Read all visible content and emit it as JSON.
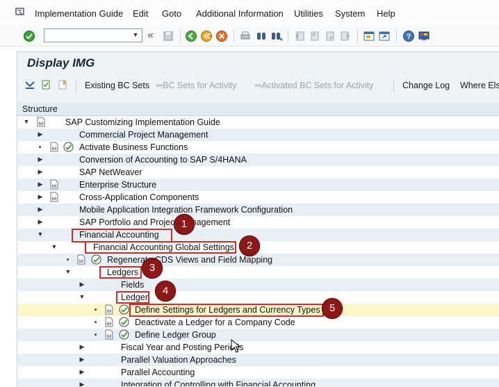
{
  "menubar": {
    "items": [
      "Implementation Guide",
      "Edit",
      "Goto",
      "Additional Information",
      "Utilities",
      "System",
      "Help"
    ]
  },
  "toolbar": {
    "command_value": "",
    "icons": [
      "enter-check-icon",
      "command-field",
      "collapse-arrows-icon",
      "save-icon",
      "back-icon",
      "exit-icon",
      "cancel-icon",
      "print-icon",
      "find-icon",
      "find-next-icon",
      "first-page-icon",
      "previous-page-icon",
      "next-page-icon",
      "last-page-icon",
      "new-session-icon",
      "shortcut-icon",
      "help-icon",
      "layout-icon"
    ]
  },
  "title": "Display IMG",
  "appbar": {
    "existing_bc_sets": "Existing BC Sets",
    "bc_sets_for_activity": "BC Sets for Activity",
    "activated_bc_sets": "Activated BC Sets for Activity",
    "change_log": "Change Log",
    "where_else": "Where Els"
  },
  "tree": {
    "header": "Structure",
    "rows": [
      {
        "label": "SAP Customizing Implementation Guide"
      },
      {
        "label": "Commercial Project Management"
      },
      {
        "label": "Activate Business Functions"
      },
      {
        "label": "Conversion of Accounting to SAP S/4HANA"
      },
      {
        "label": "SAP NetWeaver"
      },
      {
        "label": "Enterprise Structure"
      },
      {
        "label": "Cross-Application Components"
      },
      {
        "label": "Mobile Application Integration Framework Configuration"
      },
      {
        "label": "SAP Portfolio and Project Management"
      },
      {
        "label": "Financial Accounting"
      },
      {
        "label": "Financial Accounting Global Settings"
      },
      {
        "label": "Regenerate CDS Views and Field Mapping"
      },
      {
        "label": "Ledgers"
      },
      {
        "label": "Fields"
      },
      {
        "label": "Ledger"
      },
      {
        "label": "Define Settings for Ledgers and Currency Types"
      },
      {
        "label": "Deactivate a Ledger for a Company Code"
      },
      {
        "label": "Define Ledger Group"
      },
      {
        "label": "Fiscal Year and Posting Periods"
      },
      {
        "label": "Parallel Valuation Approaches"
      },
      {
        "label": "Parallel Accounting"
      },
      {
        "label": "Integration of Controlling with Financial Accounting"
      }
    ]
  },
  "annotations": [
    "1",
    "2",
    "3",
    "4",
    "5"
  ],
  "colors": {
    "annotation": "#d42a2a",
    "badge": "#8e1818",
    "selected_row": "#fdf7c8"
  }
}
